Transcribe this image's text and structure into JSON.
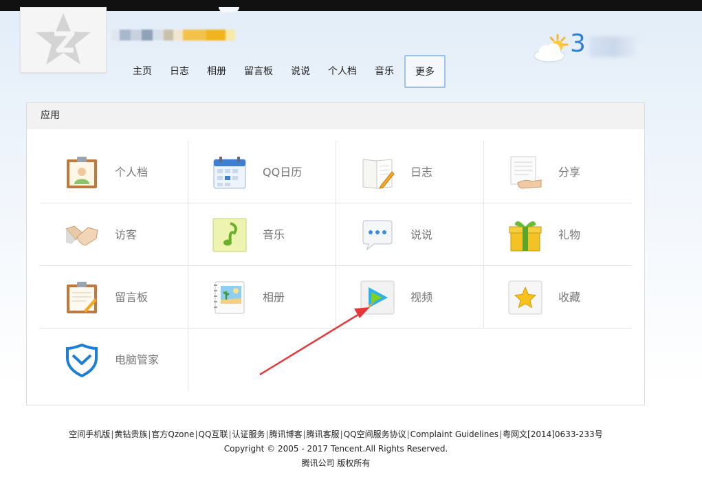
{
  "header": {
    "weather_temp": "3"
  },
  "nav": {
    "items": [
      "主页",
      "日志",
      "相册",
      "留言板",
      "说说",
      "个人档",
      "音乐",
      "更多"
    ]
  },
  "apps": {
    "title": "应用",
    "items": [
      {
        "label": "个人档",
        "icon": "profile-card-icon"
      },
      {
        "label": "QQ日历",
        "icon": "calendar-icon"
      },
      {
        "label": "日志",
        "icon": "diary-icon"
      },
      {
        "label": "分享",
        "icon": "share-icon"
      },
      {
        "label": "访客",
        "icon": "handshake-icon"
      },
      {
        "label": "音乐",
        "icon": "music-note-icon"
      },
      {
        "label": "说说",
        "icon": "speech-bubble-icon"
      },
      {
        "label": "礼物",
        "icon": "gift-icon"
      },
      {
        "label": "留言板",
        "icon": "message-board-icon"
      },
      {
        "label": "相册",
        "icon": "photo-album-icon"
      },
      {
        "label": "视频",
        "icon": "video-play-icon"
      },
      {
        "label": "收藏",
        "icon": "star-icon"
      },
      {
        "label": "电脑管家",
        "icon": "shield-icon"
      }
    ]
  },
  "footer": {
    "links": [
      "空间手机版",
      "黄钻贵族",
      "官方Qzone",
      "QQ互联",
      "认证服务",
      "腾讯博客",
      "腾讯客服",
      "QQ空间服务协议",
      "Complaint Guidelines",
      "粤网文[2014]0633-233号"
    ],
    "copyright": "Copyright © 2005 - 2017 Tencent.All Rights Reserved.",
    "company": "腾讯公司 版权所有"
  }
}
